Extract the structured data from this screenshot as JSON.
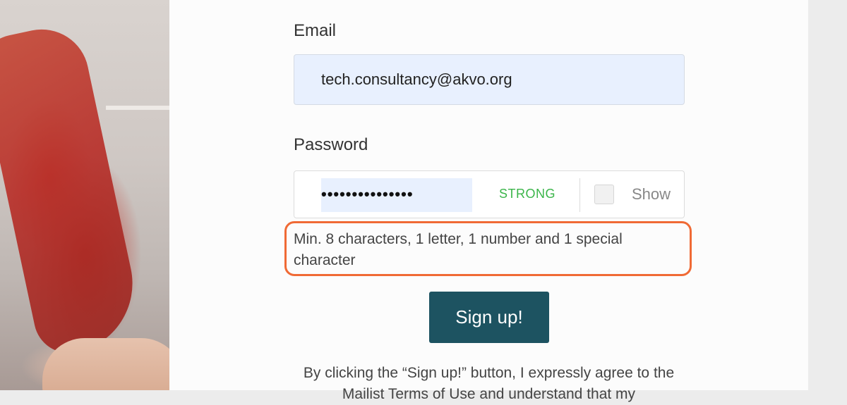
{
  "form": {
    "email_label": "Email",
    "email_value": "tech.consultancy@akvo.org",
    "password_label": "Password",
    "password_value": "•••••••••••••••",
    "strength_label": "STRONG",
    "show_label": "Show",
    "hint": "Min. 8 characters, 1 letter, 1 number and 1 special character",
    "signup_label": "Sign up!",
    "terms_text": "By clicking the “Sign up!” button, I expressly agree to the Mailist Terms of Use and understand that my"
  },
  "colors": {
    "primary_button": "#1d5361",
    "strength_green": "#3bb54a",
    "highlight_orange": "#f06a35",
    "autofill_blue": "#e8f0fe"
  }
}
